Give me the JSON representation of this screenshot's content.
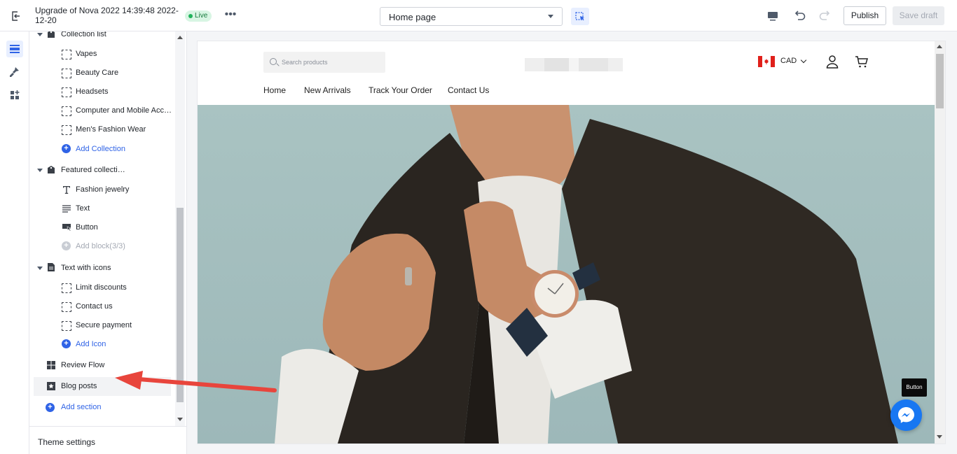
{
  "topbar": {
    "title": "Upgrade of Nova 2022 14:39:48 2022-12-20",
    "live_badge": "Live",
    "more": "•••",
    "page_select": "Home page",
    "publish_label": "Publish",
    "save_draft_label": "Save draft"
  },
  "rail": {
    "items": [
      "sections-icon",
      "theme-brush-icon",
      "apps-icon"
    ],
    "active": "sections-icon"
  },
  "sidebar": {
    "collection_list": {
      "label": "Collection list",
      "blocks": [
        "Vapes",
        "Beauty Care",
        "Headsets",
        "Computer and Mobile Accessories",
        "Men's Fashion Wear"
      ],
      "add_label": "Add Collection"
    },
    "featured_collection": {
      "label": "Featured collection",
      "blocks": [
        "Fashion jewelry",
        "Text",
        "Button"
      ],
      "add_label": "Add block(3/3)"
    },
    "text_with_icons": {
      "label": "Text with icons",
      "blocks": [
        "Limit discounts",
        "Contact us",
        "Secure payment"
      ],
      "add_label": "Add Icon"
    },
    "review_flow": "Review Flow",
    "blog_posts": "Blog posts",
    "add_section": "Add section",
    "theme_settings": "Theme settings"
  },
  "preview": {
    "search_placeholder": "Search products",
    "currency": "CAD",
    "nav": [
      "Home",
      "New Arrivals",
      "Track Your Order",
      "Contact Us"
    ],
    "tooltip": "Button"
  },
  "colors": {
    "accent": "#2f63e6",
    "live_green": "#20b35b",
    "annotation_arrow": "#e8453c",
    "messenger": "#1877f2"
  }
}
